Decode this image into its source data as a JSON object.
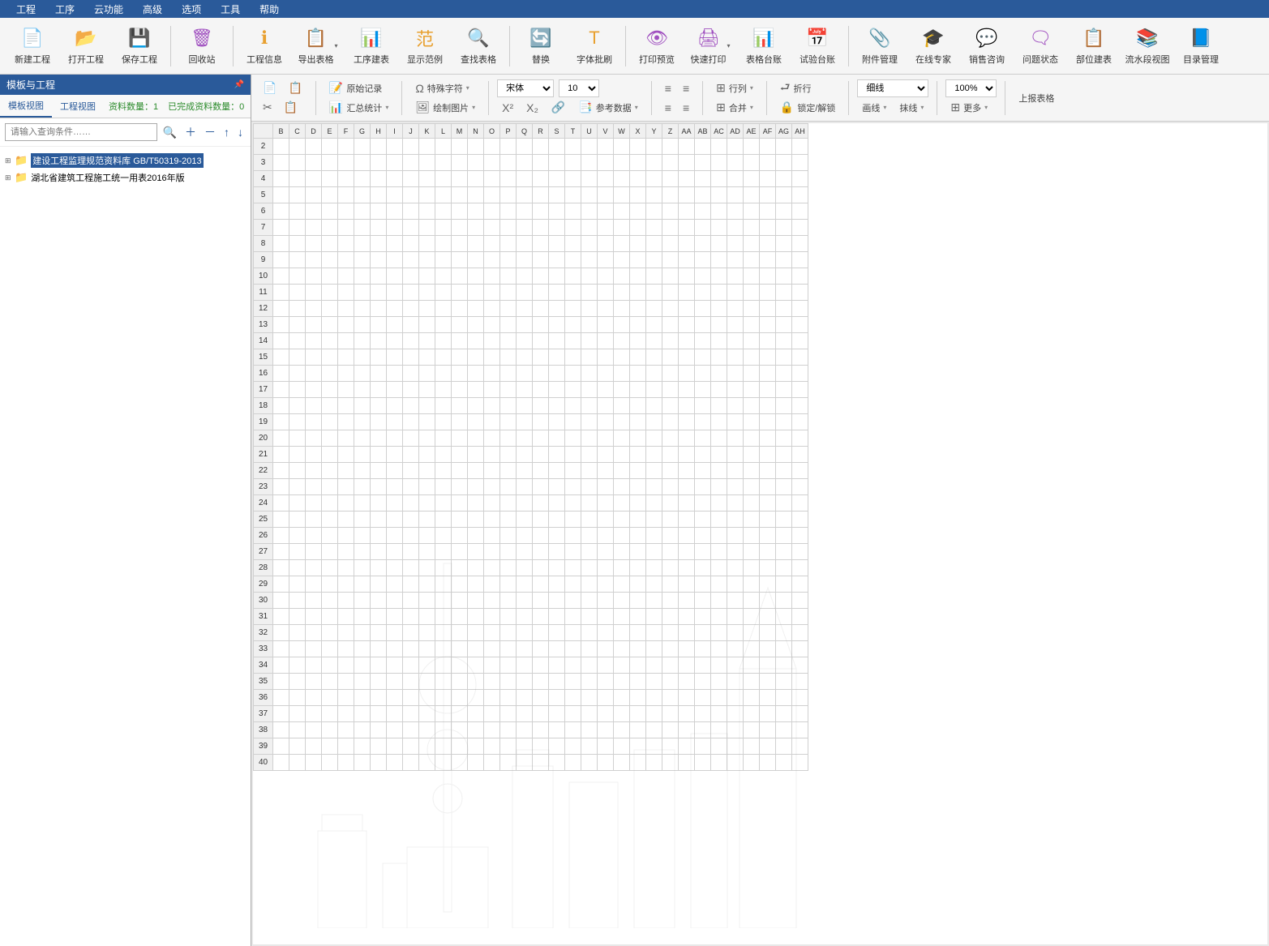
{
  "menu": {
    "items": [
      "工程",
      "工序",
      "云功能",
      "高级",
      "选项",
      "工具",
      "帮助"
    ]
  },
  "toolbar": {
    "items": [
      {
        "label": "新建工程",
        "icon": "📄",
        "color": "#2a7ad4"
      },
      {
        "label": "打开工程",
        "icon": "📂",
        "color": "#e8a030"
      },
      {
        "label": "保存工程",
        "icon": "💾",
        "color": "#2a7ad4"
      },
      {
        "sep": true
      },
      {
        "label": "回收站",
        "icon": "🗑",
        "color": "#a050c0"
      },
      {
        "sep": true
      },
      {
        "label": "工程信息",
        "icon": "ℹ",
        "color": "#e8a030"
      },
      {
        "label": "导出表格",
        "icon": "📋",
        "color": "#30a060",
        "dd": true
      },
      {
        "label": "工序建表",
        "icon": "📊",
        "color": "#e8a030"
      },
      {
        "label": "显示范例",
        "icon": "范",
        "color": "#e8a030"
      },
      {
        "label": "查找表格",
        "icon": "🔍",
        "color": "#e8a030"
      },
      {
        "sep": true
      },
      {
        "label": "替换",
        "icon": "🔄",
        "color": "#e8a030"
      },
      {
        "label": "字体批刷",
        "icon": "T",
        "color": "#e8a030"
      },
      {
        "sep": true
      },
      {
        "label": "打印预览",
        "icon": "👁",
        "color": "#a050c0"
      },
      {
        "label": "快速打印",
        "icon": "🖨",
        "color": "#a050c0",
        "dd": true
      },
      {
        "label": "表格台账",
        "icon": "📊",
        "color": "#e8a030"
      },
      {
        "label": "试验台账",
        "icon": "📅",
        "color": "#e8a030"
      },
      {
        "sep": true
      },
      {
        "label": "附件管理",
        "icon": "📎",
        "color": "#2a7ad4"
      },
      {
        "label": "在线专家",
        "icon": "🎓",
        "color": "#2a7ad4"
      },
      {
        "label": "销售咨询",
        "icon": "💬",
        "color": "#a050c0"
      },
      {
        "label": "问题状态",
        "icon": "🗨",
        "color": "#a050c0"
      },
      {
        "label": "部位建表",
        "icon": "📋",
        "color": "#a050c0"
      },
      {
        "label": "流水段视图",
        "icon": "📚",
        "color": "#e8a030"
      },
      {
        "label": "目录管理",
        "icon": "📘",
        "color": "#2a7ad4"
      }
    ]
  },
  "sidebar": {
    "title": "模板与工程",
    "tabs": [
      {
        "label": "模板视图",
        "active": true
      },
      {
        "label": "工程视图",
        "active": false
      }
    ],
    "stat1": "资料数量：1",
    "stat2": "已完成资料数量：0",
    "search_placeholder": "请输入查询条件……",
    "tree": [
      {
        "label": "建设工程监理规范资料库 GB/T50319-2013",
        "selected": true
      },
      {
        "label": "湖北省建筑工程施工统一用表2016年版",
        "selected": false
      }
    ]
  },
  "ribbon": {
    "row1": {
      "original_record": "原始记录",
      "special_char": "特殊字符",
      "row_col": "行列",
      "fold": "折行",
      "upload": "上报表格"
    },
    "row2": {
      "summary": "汇总统计",
      "draw_pic": "绘制图片",
      "ref_data": "参考数据",
      "merge": "合并",
      "lock": "锁定/解锁",
      "line": "画线",
      "erase": "抹线",
      "more": "更多"
    },
    "font_select": "宋体",
    "size_select": "10",
    "line_style": "细线",
    "zoom": "100%"
  },
  "grid": {
    "cols": [
      "B",
      "C",
      "D",
      "E",
      "F",
      "G",
      "H",
      "I",
      "J",
      "K",
      "L",
      "M",
      "N",
      "O",
      "P",
      "Q",
      "R",
      "S",
      "T",
      "U",
      "V",
      "W",
      "X",
      "Y",
      "Z",
      "AA",
      "AB",
      "AC",
      "AD",
      "AE",
      "AF",
      "AG",
      "AH"
    ],
    "rows": [
      2,
      3,
      4,
      5,
      6,
      7,
      8,
      9,
      10,
      11,
      12,
      13,
      14,
      15,
      16,
      17,
      18,
      19,
      20,
      21,
      22,
      23,
      24,
      25,
      26,
      27,
      28,
      29,
      30,
      31,
      32,
      33,
      34,
      35,
      36,
      37,
      38,
      39,
      40
    ]
  }
}
